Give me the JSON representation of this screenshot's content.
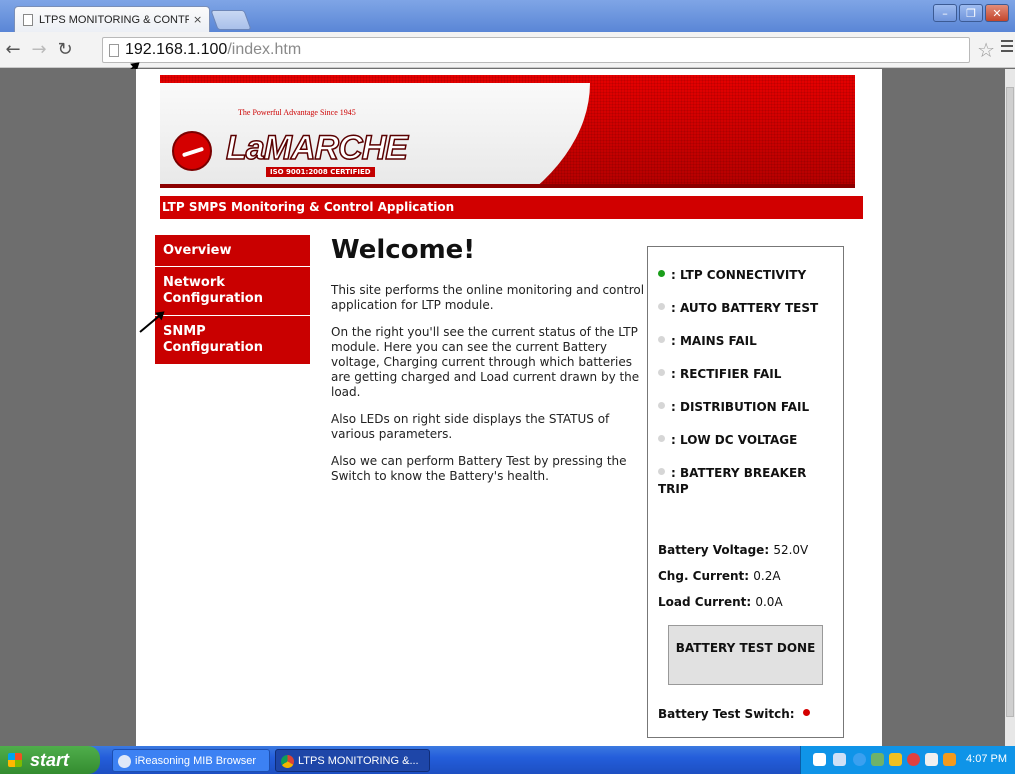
{
  "browser": {
    "tab_title": "LTPS MONITORING & CONTR",
    "tab_close": "×",
    "url_host": "192.168.1.100",
    "url_path": "/index.htm"
  },
  "banner": {
    "tagline": "The Powerful Advantage     Since 1945",
    "brand": "LaMARCHE",
    "certification": "ISO 9001:2008 CERTIFIED"
  },
  "app_title": "LTP SMPS Monitoring & Control Application",
  "menu": {
    "items": [
      {
        "label": "Overview"
      },
      {
        "label": "Network Configuration"
      },
      {
        "label": "SNMP Configuration"
      }
    ]
  },
  "content": {
    "heading": "Welcome!",
    "paragraphs": [
      "This site performs the online monitoring and control application for LTP module.",
      "On the right you'll see the current status of the LTP module. Here you can see the current Battery voltage, Charging current through which batteries are getting charged and Load current drawn by the load.",
      "Also LEDs on right side displays the STATUS of various parameters.",
      "Also we can perform Battery Test by pressing the Switch to know the Battery's health."
    ]
  },
  "status": {
    "leds": [
      {
        "label": ": LTP CONNECTIVITY",
        "color": "#1a9e1a"
      },
      {
        "label": ": AUTO BATTERY TEST",
        "color": "#d6d6d6"
      },
      {
        "label": ": MAINS FAIL",
        "color": "#d6d6d6"
      },
      {
        "label": ": RECTIFIER FAIL",
        "color": "#d6d6d6"
      },
      {
        "label": ": DISTRIBUTION FAIL",
        "color": "#d6d6d6"
      },
      {
        "label": ": LOW DC VOLTAGE",
        "color": "#d6d6d6"
      },
      {
        "label": ": BATTERY BREAKER TRIP",
        "color": "#d6d6d6"
      }
    ],
    "battery_voltage_label": "Battery Voltage:",
    "battery_voltage_value": "52.0V",
    "chg_current_label": "Chg. Current:",
    "chg_current_value": "0.2A",
    "load_current_label": "Load Current:",
    "load_current_value": "0.0A",
    "battery_test_button": "BATTERY TEST DONE",
    "switch_label": "Battery Test Switch:",
    "switch_color": "#d40000"
  },
  "taskbar": {
    "start_label": "start",
    "tasks": [
      {
        "label": "iReasoning MIB Browser"
      },
      {
        "label": "LTPS MONITORING &..."
      }
    ],
    "clock": "4:07 PM"
  }
}
